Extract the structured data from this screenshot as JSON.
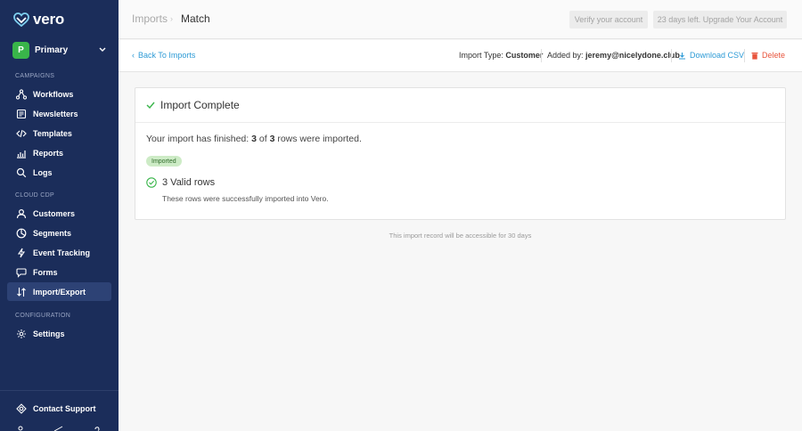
{
  "app": {
    "logo_text": "vero"
  },
  "account": {
    "initial": "P",
    "name": "Primary"
  },
  "sidebar": {
    "sections": [
      {
        "label": "CAMPAIGNS"
      },
      {
        "label": "CLOUD CDP"
      },
      {
        "label": "CONFIGURATION"
      }
    ],
    "items": [
      {
        "label": "Workflows",
        "icon": "workflow-icon"
      },
      {
        "label": "Newsletters",
        "icon": "newsletter-icon"
      },
      {
        "label": "Templates",
        "icon": "code-icon"
      },
      {
        "label": "Reports",
        "icon": "chart-icon"
      },
      {
        "label": "Logs",
        "icon": "search-icon"
      },
      {
        "label": "Customers",
        "icon": "person-icon"
      },
      {
        "label": "Segments",
        "icon": "pie-icon"
      },
      {
        "label": "Event Tracking",
        "icon": "bolt-icon"
      },
      {
        "label": "Forms",
        "icon": "chat-icon"
      },
      {
        "label": "Import/Export",
        "icon": "import-export-icon",
        "active": true
      },
      {
        "label": "Settings",
        "icon": "gear-icon"
      }
    ],
    "footer": {
      "label": "Contact Support",
      "icon": "support-icon"
    }
  },
  "header": {
    "breadcrumb": [
      "Imports",
      "Match"
    ],
    "verify_label": "Verify your account",
    "upgrade_label": "23 days left. Upgrade Your Account"
  },
  "subbar": {
    "back_label": "Back To Imports",
    "import_type_label": "Import Type:",
    "import_type_value": "Customer",
    "added_by_label": "Added by:",
    "added_by_value": "jeremy@nicelydone.club",
    "download_label": "Download CSV",
    "delete_label": "Delete"
  },
  "card": {
    "title": "Import Complete",
    "summary_prefix": "Your import has finished:",
    "summary_imported": "3",
    "summary_of": "of",
    "summary_total": "3",
    "summary_suffix": "rows were imported.",
    "badge": "Imported",
    "valid_title": "3 Valid rows",
    "valid_desc": "These rows were successfully imported into Vero."
  },
  "retention_note": "This import record will be accessible for 30 days",
  "colors": {
    "sidebar_bg": "#1b2d5a",
    "accent_link": "#2e9bd6",
    "delete": "#e8543c",
    "success": "#39b54a"
  }
}
